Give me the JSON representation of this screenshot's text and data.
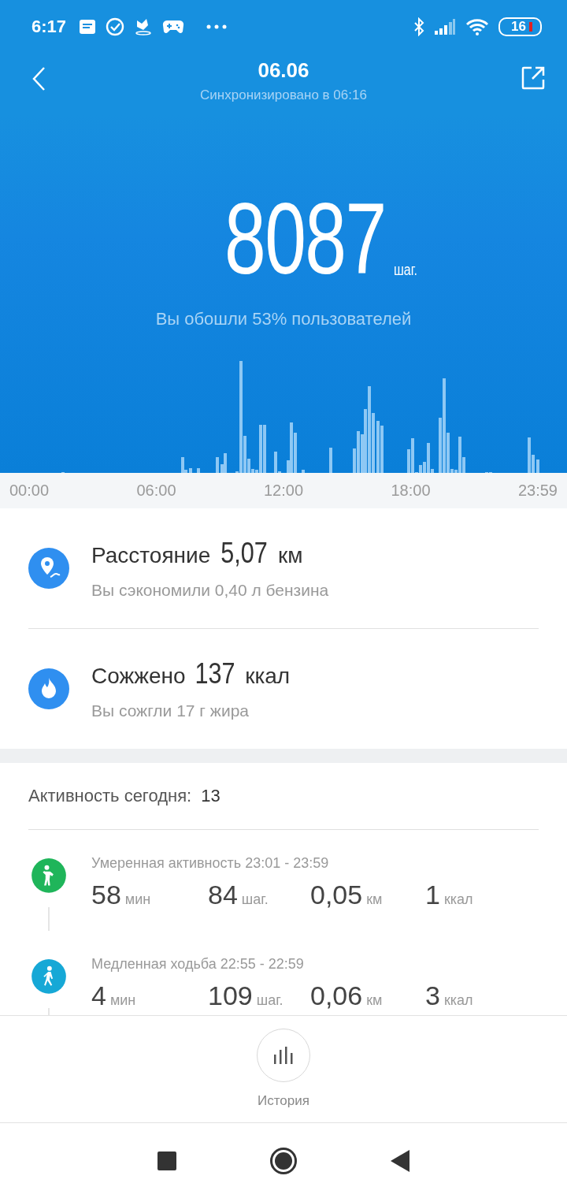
{
  "status_bar": {
    "time": "6:17",
    "battery": "16"
  },
  "header": {
    "title": "06.06",
    "subtitle": "Синхронизировано в 06:16"
  },
  "summary": {
    "steps": "8087",
    "unit": "шаг.",
    "comparison": "Вы обошли 53% пользователей"
  },
  "chart": {
    "axis_labels": [
      "00:00",
      "06:00",
      "12:00",
      "18:00",
      "23:59"
    ]
  },
  "stats": [
    {
      "kind": "distance",
      "label": "Расстояние",
      "value": "5,07",
      "unit": "км",
      "note": "Вы сэкономили 0,40 л бензина"
    },
    {
      "kind": "calories",
      "label": "Сожжено",
      "value": "137",
      "unit": "ккал",
      "note": "Вы сожгли 17 г жира"
    }
  ],
  "activity": {
    "label": "Активность сегодня:",
    "count": "13",
    "entries": [
      {
        "kind": "moderate",
        "title": "Умеренная активность 23:01 - 23:59",
        "metrics": [
          {
            "value": "58",
            "unit": "мин"
          },
          {
            "value": "84",
            "unit": "шаг."
          },
          {
            "value": "0,05",
            "unit": "км"
          },
          {
            "value": "1",
            "unit": "ккал"
          }
        ]
      },
      {
        "kind": "walk",
        "title": "Медленная ходьба 22:55 - 22:59",
        "metrics": [
          {
            "value": "4",
            "unit": "мин"
          },
          {
            "value": "109",
            "unit": "шаг."
          },
          {
            "value": "0,06",
            "unit": "км"
          },
          {
            "value": "3",
            "unit": "ккал"
          }
        ]
      }
    ]
  },
  "history_button": {
    "label": "История"
  }
}
